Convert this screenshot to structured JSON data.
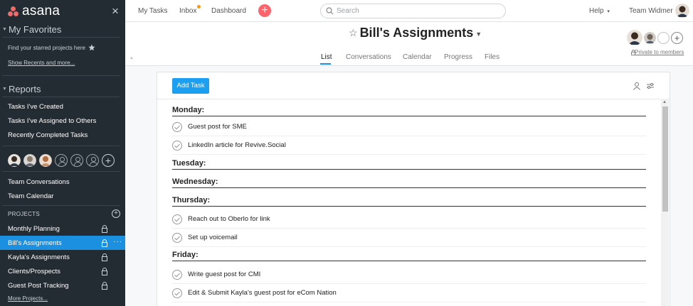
{
  "sidebar": {
    "logo_text": "asana",
    "close_symbol": "×",
    "favorites_header": "My Favorites",
    "favorites_hint": "Find your starred projects here",
    "show_recents": "Show Recents and more...",
    "reports_header": "Reports",
    "reports": [
      "Tasks I've Created",
      "Tasks I've Assigned to Others",
      "Recently Completed Tasks"
    ],
    "team_links": [
      "Team Conversations",
      "Team Calendar"
    ],
    "projects_label": "PROJECTS",
    "projects": [
      {
        "name": "Monthly Planning",
        "active": false
      },
      {
        "name": "Bill's Assignments",
        "active": true
      },
      {
        "name": "Kayla's Assignments",
        "active": false
      },
      {
        "name": "Clients/Prospects",
        "active": false
      },
      {
        "name": "Guest Post Tracking",
        "active": false
      }
    ],
    "more_projects": "More Projects..."
  },
  "topbar": {
    "my_tasks": "My Tasks",
    "inbox": "Inbox",
    "dashboard": "Dashboard",
    "search_placeholder": "Search",
    "help": "Help",
    "team": "Team Widmer"
  },
  "project": {
    "title": "Bill's Assignments",
    "tabs": [
      "List",
      "Conversations",
      "Calendar",
      "Progress",
      "Files"
    ],
    "active_tab": "List",
    "privacy": "Private to members"
  },
  "toolbar": {
    "add_task": "Add Task"
  },
  "list": {
    "sections": [
      {
        "name": "Monday:",
        "tasks": [
          "Guest post for SME",
          "LinkedIn article for Revive.Social"
        ]
      },
      {
        "name": "Tuesday:",
        "tasks": []
      },
      {
        "name": "Wednesday:",
        "tasks": []
      },
      {
        "name": "Thursday:",
        "tasks": [
          "Reach out to Oberlo for link",
          "Set up voicemail"
        ]
      },
      {
        "name": "Friday:",
        "tasks": [
          "Write guest post for CMI",
          "Edit & Submit Kayla's guest post for eCom Nation"
        ]
      }
    ]
  },
  "colors": {
    "sidebar_bg": "#232b33",
    "accent_blue": "#1b8fe0",
    "add_button": "#fc636b",
    "inbox_dot": "#fd9a00",
    "logo": "#f06a6a"
  },
  "icons": [
    "star-icon",
    "search-icon",
    "lock-icon",
    "plus-icon",
    "person-icon",
    "filter-icon",
    "checkmark-icon",
    "chevron-right-icon"
  ]
}
